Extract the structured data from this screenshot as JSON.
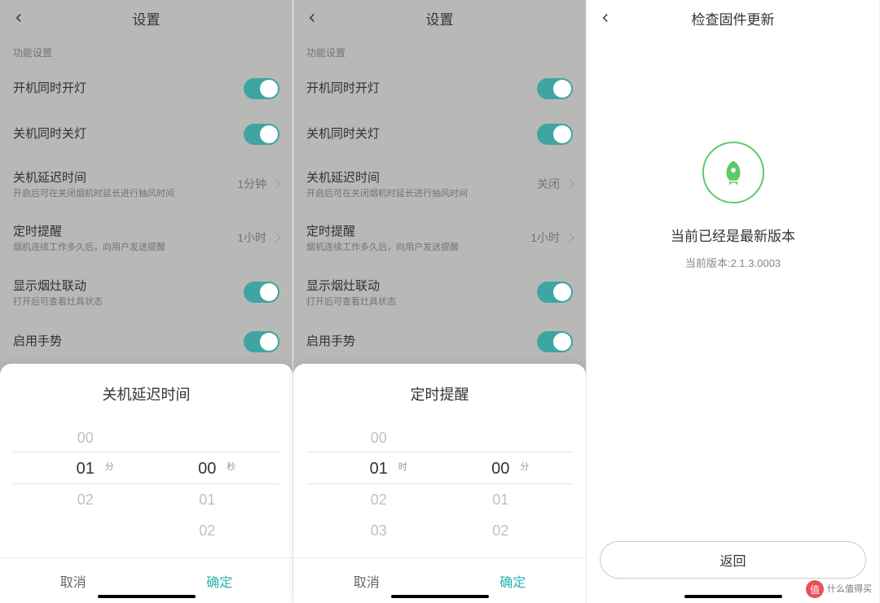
{
  "screen1": {
    "title": "设置",
    "section_label": "功能设置",
    "rows": [
      {
        "title": "开机同时开灯",
        "sub": "",
        "type": "toggle"
      },
      {
        "title": "关机同时关灯",
        "sub": "",
        "type": "toggle"
      },
      {
        "title": "关机延迟时间",
        "sub": "开启后可在关闭烟机时延长进行抽风时间",
        "type": "value",
        "value": "1分钟"
      },
      {
        "title": "定时提醒",
        "sub": "烟机连续工作多久后，向用户发送提醒",
        "type": "value",
        "value": "1小时"
      },
      {
        "title": "显示烟灶联动",
        "sub": "打开后可查看灶具状态",
        "type": "toggle"
      },
      {
        "title": "启用手势",
        "sub": "",
        "type": "toggle"
      }
    ],
    "sheet": {
      "title": "关机延迟时间",
      "col1_unit": "分",
      "col2_unit": "秒",
      "col1": [
        "00",
        "01",
        "02"
      ],
      "col2": [
        "",
        "00",
        "01",
        "02"
      ],
      "cancel": "取消",
      "confirm": "确定"
    }
  },
  "screen2": {
    "title": "设置",
    "section_label": "功能设置",
    "rows": [
      {
        "title": "开机同时开灯",
        "sub": "",
        "type": "toggle"
      },
      {
        "title": "关机同时关灯",
        "sub": "",
        "type": "toggle"
      },
      {
        "title": "关机延迟时间",
        "sub": "开启后可在关闭烟机时延长进行抽风时间",
        "type": "value",
        "value": "关闭"
      },
      {
        "title": "定时提醒",
        "sub": "烟机连续工作多久后，向用户发送提醒",
        "type": "value",
        "value": "1小时"
      },
      {
        "title": "显示烟灶联动",
        "sub": "打开后可查看灶具状态",
        "type": "toggle"
      },
      {
        "title": "启用手势",
        "sub": "",
        "type": "toggle"
      }
    ],
    "sheet": {
      "title": "定时提醒",
      "col1_unit": "时",
      "col2_unit": "分",
      "col1": [
        "00",
        "01",
        "02",
        "03"
      ],
      "col2": [
        "",
        "00",
        "01",
        "02"
      ],
      "cancel": "取消",
      "confirm": "确定"
    }
  },
  "screen3": {
    "title": "检查固件更新",
    "message": "当前已经是最新版本",
    "version_label": "当前版本:2.1.3.0003",
    "back_button": "返回"
  },
  "watermark": {
    "icon_text": "值",
    "line1": "什么值得买",
    "line2": ""
  }
}
